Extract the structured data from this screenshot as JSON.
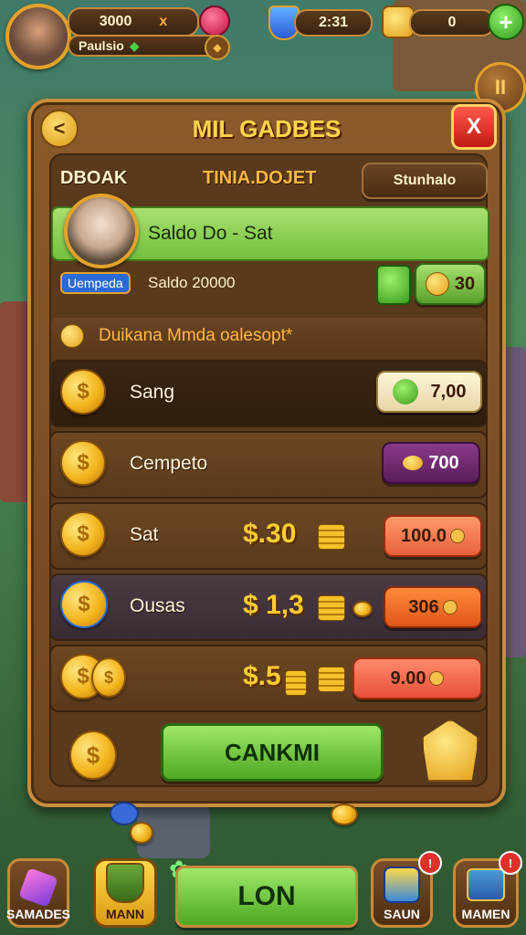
{
  "hud": {
    "coins_value": "3000",
    "multiplier": "x",
    "player_name": "Paulsio",
    "gems_value": "2:31",
    "tokens_value": "0",
    "add_label": "+",
    "pause_label": "II"
  },
  "panel": {
    "title": "MIL GADBES",
    "back_label": "<",
    "close_label": "X",
    "tab_left": "DBOAK",
    "tab_center": "TINIA.DOJET",
    "tab_right_button": "Stunhalo",
    "profile_banner": "Saldo Do - Sat",
    "profile_tag": "Uempeda",
    "profile_balance": "Saldo 20000",
    "profile_coin_count": "30",
    "section_header": "Duikana Mmda oalesopt*"
  },
  "rows": [
    {
      "label": "Sang",
      "price": "",
      "button": "7,00",
      "button_color": "#f2e6c6"
    },
    {
      "label": "Cempeto",
      "price": "",
      "button": "700",
      "button_color": "#6a2c6a"
    },
    {
      "label": "Sat",
      "price": "$.30",
      "button": "100.0",
      "button_color": "#f07a50"
    },
    {
      "label": "Ousas",
      "price": "$ 1,3",
      "button": "306",
      "button_color": "#f06a2a"
    },
    {
      "label": "",
      "price": "$.5",
      "button": "9.00",
      "button_color": "#f0704a"
    }
  ],
  "confirm_button": "CANKMI",
  "bottom_bar": {
    "left_label": "SAMADES",
    "second_label": "MANN",
    "center_label": "LON",
    "right1_label": "SAUN",
    "right2_label": "MAMEN",
    "badge_1": "!",
    "badge_2": "!"
  },
  "icons": [
    "coin-icon",
    "gem-icon",
    "shield-icon",
    "plus-icon",
    "pause-icon",
    "close-icon",
    "back-arrow-icon",
    "chest-icon"
  ]
}
